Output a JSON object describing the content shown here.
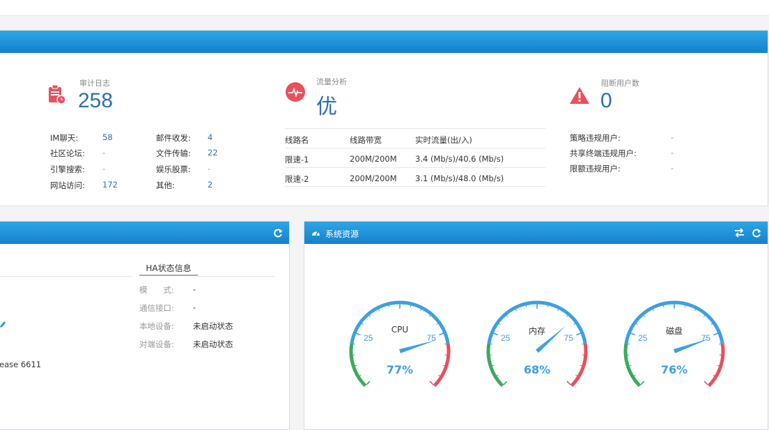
{
  "summary": {
    "audit": {
      "title": "审计日志",
      "value": "258"
    },
    "traffic": {
      "title": "流量分析",
      "value": "优"
    },
    "blocked": {
      "title": "阻断用户数",
      "value": "0"
    },
    "audit_items": [
      {
        "label": "IM聊天:",
        "value": "58"
      },
      {
        "label": "社区论坛:",
        "value": "-"
      },
      {
        "label": "引擎搜索:",
        "value": "-"
      },
      {
        "label": "网站访问:",
        "value": "172"
      },
      {
        "label": "邮件收发:",
        "value": "4"
      },
      {
        "label": "文件传输:",
        "value": "22"
      },
      {
        "label": "娱乐股票:",
        "value": "-"
      },
      {
        "label": "其他:",
        "value": "2"
      }
    ],
    "line_table": {
      "headers": [
        "线路名",
        "线路带宽",
        "实时流量(出/入)"
      ],
      "rows": [
        [
          "限速-1",
          "200M/200M",
          "3.4 (Mb/s)/40.6 (Mb/s)"
        ],
        [
          "限速-2",
          "200M/200M",
          "3.1 (Mb/s)/48.0 (Mb/s)"
        ]
      ]
    },
    "blocked_items": [
      {
        "label": "策略违规用户:",
        "value": "-"
      },
      {
        "label": "共享终端违规用户:",
        "value": "-"
      },
      {
        "label": "限额违规用户:",
        "value": "-"
      }
    ]
  },
  "left_panel": {
    "ha_tab": "HA状态信息",
    "ha_rows": [
      {
        "label": "模　　式:",
        "value": "-"
      },
      {
        "label": "通信接口:",
        "value": "-"
      },
      {
        "label": "本地设备:",
        "value": "未启动状态"
      },
      {
        "label": "对端设备:",
        "value": "未启动状态"
      }
    ],
    "partial_text": "ease 6611"
  },
  "resources": {
    "title": "系统资源",
    "gauges": [
      {
        "name": "CPU",
        "percent": 77,
        "label": "77%"
      },
      {
        "name": "内存",
        "percent": 68,
        "label": "68%"
      },
      {
        "name": "磁盘",
        "percent": 76,
        "label": "76%"
      }
    ],
    "tick_low": "25",
    "tick_high": "75"
  },
  "colors": {
    "accent": "#1e8fd8",
    "value_blue": "#2e6fad",
    "alert_red": "#e8505b"
  }
}
